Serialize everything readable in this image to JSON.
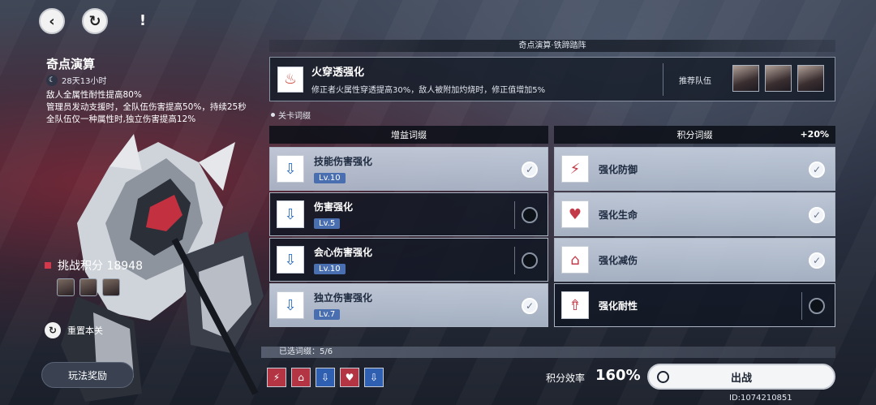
{
  "top": {
    "back_icon": "‹",
    "refresh_icon": "↻",
    "alert_icon": "!"
  },
  "left": {
    "title": "奇点演算",
    "timer": "28天13小时",
    "desc": [
      "敌人全属性耐性提高80%",
      "管理员发动支援时，全队伍伤害提高50%，持续25秒",
      "全队伍仅一种属性时,独立伤害提高12%"
    ],
    "score": "挑战积分 18948",
    "reset_label": "重置本关",
    "reward_label": "玩法奖励"
  },
  "stage_header": "奇点演算·铁蹄踏阵",
  "modifier": {
    "title": "火穿透强化",
    "body": "修正者火属性穿透提高30%，敌人被附加灼烧时，修正值增加5%",
    "recommend_label": "推荐队伍"
  },
  "section_label": "关卡词缀",
  "columns": {
    "left_title": "增益词缀",
    "right_title": "积分词缀",
    "right_bonus": "+20%"
  },
  "buffs": [
    {
      "name": "技能伤害强化",
      "lv": "Lv.10",
      "selected": true
    },
    {
      "name": "伤害强化",
      "lv": "Lv.5",
      "selected": false
    },
    {
      "name": "会心伤害强化",
      "lv": "Lv.10",
      "selected": false
    },
    {
      "name": "独立伤害强化",
      "lv": "Lv.7",
      "selected": true
    }
  ],
  "score_mods": [
    {
      "name": "强化防御",
      "selected": true
    },
    {
      "name": "强化生命",
      "selected": true
    },
    {
      "name": "强化减伤",
      "selected": true
    },
    {
      "name": "强化耐性",
      "selected": false
    }
  ],
  "bottom": {
    "selected_text": "已选词缀：5/6",
    "efficiency_label": "积分效率",
    "efficiency_value": "160%",
    "start_label": "出战",
    "uid": "ID:1074210851"
  },
  "colors": {
    "buff_icon": "#2d6fc4",
    "score_icon": "#c33b48",
    "accent_red": "#d4384a"
  }
}
